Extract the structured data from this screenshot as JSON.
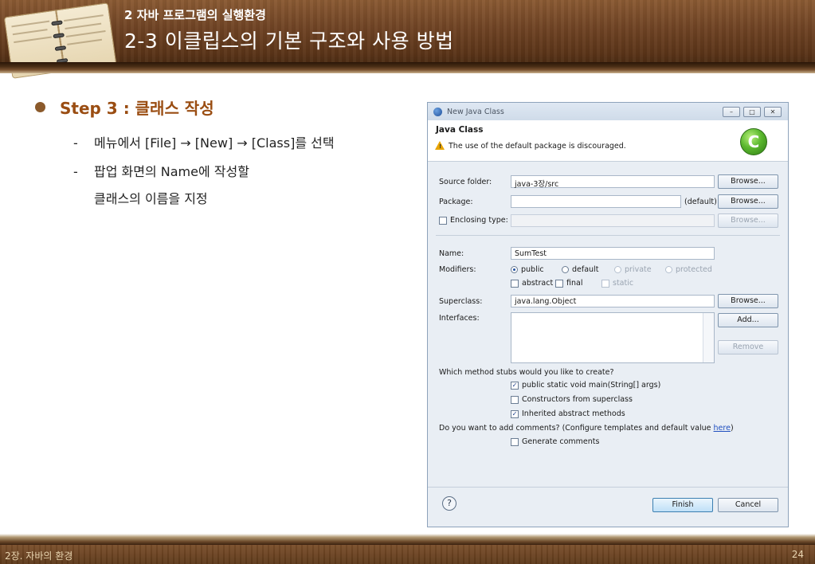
{
  "header": {
    "subtitle": "2 자바 프로그램의 실행환경",
    "title": "2-3 이클립스의 기본 구조와 사용 방법"
  },
  "content": {
    "step_title": "Step 3 : 클래스 작성",
    "items": [
      {
        "dash": "-",
        "text": "메뉴에서 [File] → [New] → [Class]를 선택"
      },
      {
        "dash": "-",
        "text": "팝업 화면의 Name에 작성할"
      }
    ],
    "item2_continuation": "클래스의 이름을 지정"
  },
  "dialog": {
    "window_title": "New Java Class",
    "banner_title": "Java Class",
    "banner_message": "The use of the default package is discouraged.",
    "logo_letter": "C",
    "source_folder_label": "Source folder:",
    "source_folder_value": "java-3장/src",
    "package_label": "Package:",
    "package_value": "",
    "package_default": "(default)",
    "enclosing_label": "Enclosing type:",
    "browse_label": "Browse...",
    "name_label": "Name:",
    "name_value": "SumTest",
    "modifiers_label": "Modifiers:",
    "modifiers": [
      {
        "label": "public",
        "selected": true
      },
      {
        "label": "default",
        "selected": false
      },
      {
        "label": "private",
        "selected": false
      },
      {
        "label": "protected",
        "selected": false
      }
    ],
    "mod_checks": [
      {
        "label": "abstract",
        "checked": false
      },
      {
        "label": "final",
        "checked": false
      },
      {
        "label": "static",
        "checked": false
      }
    ],
    "superclass_label": "Superclass:",
    "superclass_value": "java.lang.Object",
    "interfaces_label": "Interfaces:",
    "add_label": "Add...",
    "remove_label": "Remove",
    "stubs_question": "Which method stubs would you like to create?",
    "stubs": [
      {
        "label": "public static void main(String[] args)",
        "checked": true
      },
      {
        "label": "Constructors from superclass",
        "checked": false
      },
      {
        "label": "Inherited abstract methods",
        "checked": true
      }
    ],
    "comments_question_pre": "Do you want to add comments? (Configure templates and default value ",
    "comments_link": "here",
    "comments_question_post": ")",
    "generate_comments": "Generate comments",
    "finish_label": "Finish",
    "cancel_label": "Cancel",
    "help_glyph": "?"
  },
  "footer": {
    "chapter": "2장. 자바의 환경",
    "page": "24"
  }
}
